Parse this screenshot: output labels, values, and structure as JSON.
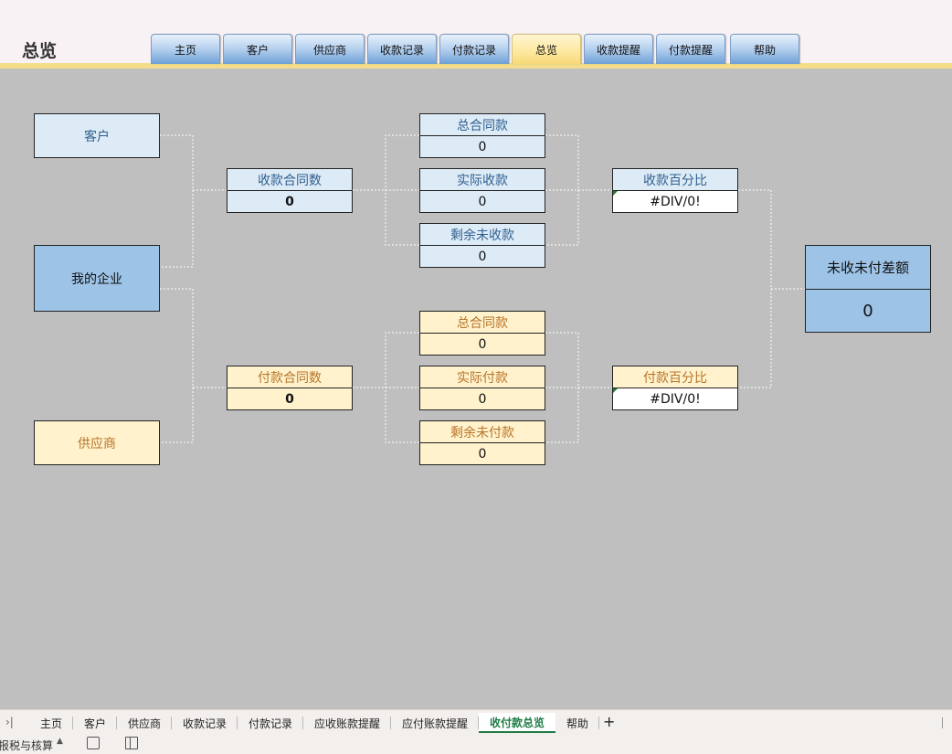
{
  "header": {
    "title": "总览",
    "tabs": [
      {
        "label": "主页",
        "active": false
      },
      {
        "label": "客户",
        "active": false
      },
      {
        "label": "供应商",
        "active": false
      },
      {
        "label": "收款记录",
        "active": false
      },
      {
        "label": "付款记录",
        "active": false
      },
      {
        "label": "总览",
        "active": true
      },
      {
        "label": "收款提醒",
        "active": false
      },
      {
        "label": "付款提醒",
        "active": false
      },
      {
        "label": "帮助",
        "active": false
      }
    ]
  },
  "diagram": {
    "customer": "客户",
    "my_company": "我的企业",
    "supplier": "供应商",
    "receipt_contracts": {
      "label": "收款合同数",
      "value": "0"
    },
    "payment_contracts": {
      "label": "付款合同数",
      "value": "0"
    },
    "receipt_total": {
      "label": "总合同款",
      "value": "0"
    },
    "receipt_actual": {
      "label": "实际收款",
      "value": "0"
    },
    "receipt_remaining": {
      "label": "剩余未收款",
      "value": "0"
    },
    "payment_total": {
      "label": "总合同款",
      "value": "0"
    },
    "payment_actual": {
      "label": "实际付款",
      "value": "0"
    },
    "payment_remaining": {
      "label": "剩余未付款",
      "value": "0"
    },
    "receipt_percent": {
      "label": "收款百分比",
      "value": "#DIV/0!"
    },
    "payment_percent": {
      "label": "付款百分比",
      "value": "#DIV/0!"
    },
    "difference": {
      "label": "未收未付差额",
      "value": "0"
    }
  },
  "sheet_tabs": {
    "items": [
      "主页",
      "客户",
      "供应商",
      "收款记录",
      "付款记录",
      "应收账款提醒",
      "应付账款提醒",
      "收付款总览",
      "帮助"
    ],
    "active": "收付款总览",
    "add_label": "+"
  },
  "statusbar": {
    "text": "报税与核算"
  },
  "colors": {
    "blue_light": "#ddebf7",
    "blue_dark": "#9dc3e6",
    "yellow_light": "#fff2cc",
    "header_accent": "#f4dd8a",
    "active_sheet": "#1e7b45"
  }
}
